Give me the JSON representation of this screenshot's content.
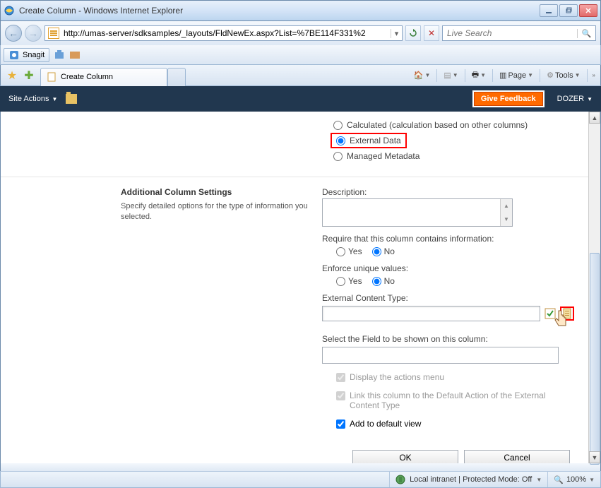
{
  "window": {
    "title": "Create Column - Windows Internet Explorer"
  },
  "nav": {
    "url": "http://umas-server/sdksamples/_layouts/FldNewEx.aspx?List=%7BE114F331%2",
    "search_placeholder": "Live Search"
  },
  "snagit": {
    "label": "Snagit"
  },
  "tabs": {
    "active": "Create Column"
  },
  "toolbar": {
    "page": "Page",
    "tools": "Tools"
  },
  "ribbon": {
    "site_actions": "Site Actions",
    "feedback": "Give Feedback",
    "user": "DOZER"
  },
  "form": {
    "type_options": {
      "calculated": "Calculated (calculation based on other columns)",
      "external": "External Data",
      "managed": "Managed Metadata"
    },
    "section_title": "Additional Column Settings",
    "section_desc": "Specify detailed options for the type of information you selected.",
    "description_label": "Description:",
    "require_label": "Require that this column contains information:",
    "enforce_label": "Enforce unique values:",
    "yes": "Yes",
    "no": "No",
    "ect_label": "External Content Type:",
    "select_field_label": "Select the Field to be shown on this column:",
    "display_actions": "Display the actions menu",
    "link_default": "Link this column to the Default Action of the External Content Type",
    "add_default_view": "Add to default view",
    "ok": "OK",
    "cancel": "Cancel"
  },
  "status": {
    "zone": "Local intranet | Protected Mode: Off",
    "zoom": "100%"
  }
}
